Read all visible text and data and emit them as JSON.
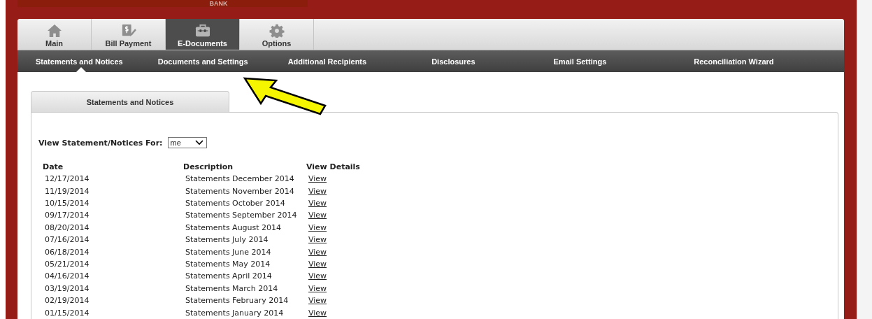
{
  "header": {
    "bank_name": "BANK"
  },
  "main_tabs": [
    {
      "label": "Main",
      "selected": false
    },
    {
      "label": "Bill Payment",
      "selected": false
    },
    {
      "label": "E-Documents",
      "selected": true
    },
    {
      "label": "Options",
      "selected": false
    }
  ],
  "sub_nav": [
    {
      "label": "Statements and Notices",
      "selected": true
    },
    {
      "label": "Documents and Settings",
      "selected": false
    },
    {
      "label": "Additional Recipients",
      "selected": false
    },
    {
      "label": "Disclosures",
      "selected": false
    },
    {
      "label": "Email Settings",
      "selected": false
    },
    {
      "label": "Reconciliation Wizard",
      "selected": false
    }
  ],
  "panel_tabs": [
    {
      "label": "Statements and Notices",
      "selected": true
    }
  ],
  "filter": {
    "label": "View Statement/Notices For:",
    "value": "me"
  },
  "table": {
    "columns": [
      "Date",
      "Description",
      "View Details"
    ],
    "rows": [
      {
        "date": "12/17/2014",
        "description": "Statements December 2014",
        "link": "View"
      },
      {
        "date": "11/19/2014",
        "description": "Statements November 2014",
        "link": "View"
      },
      {
        "date": "10/15/2014",
        "description": "Statements October 2014",
        "link": "View"
      },
      {
        "date": "09/17/2014",
        "description": "Statements September 2014",
        "link": "View"
      },
      {
        "date": "08/20/2014",
        "description": "Statements August 2014",
        "link": "View"
      },
      {
        "date": "07/16/2014",
        "description": "Statements July 2014",
        "link": "View"
      },
      {
        "date": "06/18/2014",
        "description": "Statements June 2014",
        "link": "View"
      },
      {
        "date": "05/21/2014",
        "description": "Statements May 2014",
        "link": "View"
      },
      {
        "date": "04/16/2014",
        "description": "Statements April 2014",
        "link": "View"
      },
      {
        "date": "03/19/2014",
        "description": "Statements March 2014",
        "link": "View"
      },
      {
        "date": "02/19/2014",
        "description": "Statements February 2014",
        "link": "View"
      },
      {
        "date": "01/15/2014",
        "description": "Statements January 2014",
        "link": "View"
      }
    ]
  }
}
